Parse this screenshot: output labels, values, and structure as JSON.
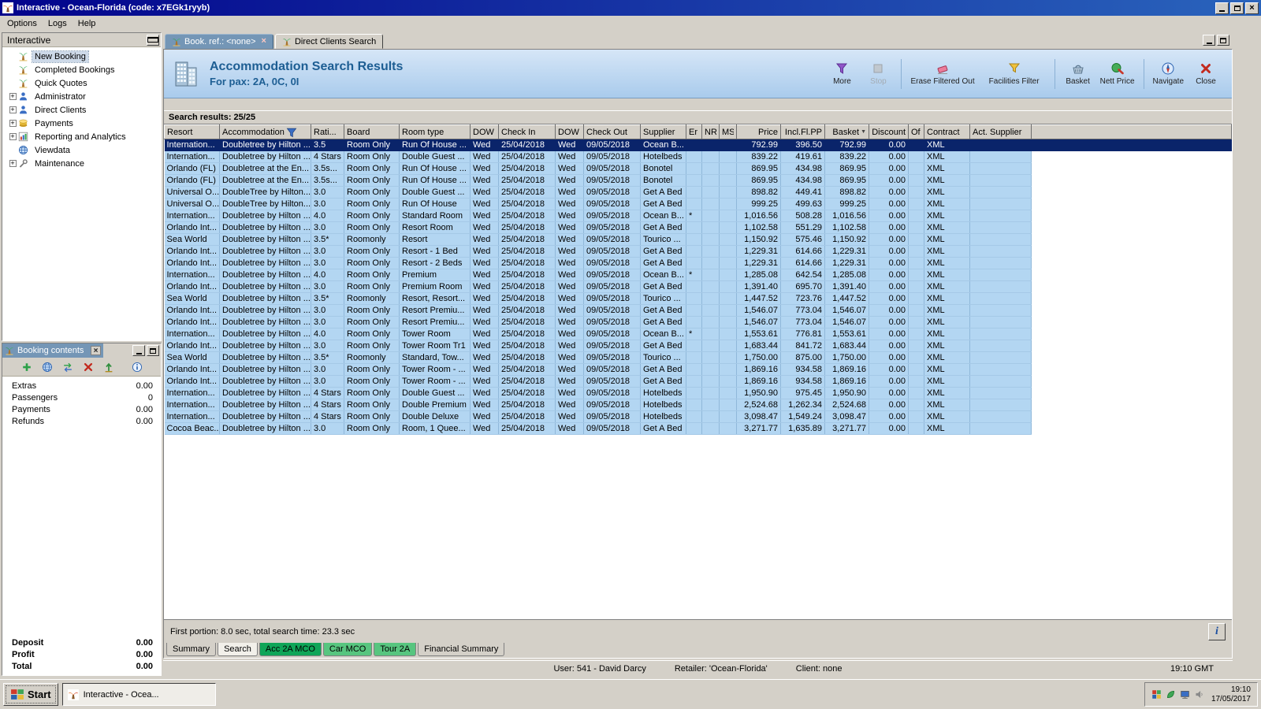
{
  "accent": {
    "selection_blue": "#0a246a",
    "row_blue": "#b3d6f2",
    "header_blue": "#a9cbec",
    "tab_green": "#0fa558",
    "caption_slate": "#7496b6"
  },
  "window": {
    "title": "Interactive - Ocean-Florida (code: x7EGk1ryyb)",
    "menu": [
      {
        "label": "Options"
      },
      {
        "label": "Logs"
      },
      {
        "label": "Help"
      }
    ]
  },
  "sidebar": {
    "title": "Interactive",
    "items": [
      {
        "label": "New Booking",
        "icon": "palm-icon",
        "expandable": false,
        "selected": true
      },
      {
        "label": "Completed Bookings",
        "icon": "palm-icon",
        "expandable": false,
        "selected": false
      },
      {
        "label": "Quick Quotes",
        "icon": "palm-icon",
        "expandable": false,
        "selected": false
      },
      {
        "label": "Administrator",
        "icon": "person-icon",
        "expandable": true,
        "selected": false
      },
      {
        "label": "Direct Clients",
        "icon": "person-icon",
        "expandable": true,
        "selected": false
      },
      {
        "label": "Payments",
        "icon": "payment-icon",
        "expandable": true,
        "selected": false
      },
      {
        "label": "Reporting and Analytics",
        "icon": "report-icon",
        "expandable": true,
        "selected": false
      },
      {
        "label": "Viewdata",
        "icon": "globe-icon",
        "expandable": false,
        "selected": false
      },
      {
        "label": "Maintenance",
        "icon": "tools-icon",
        "expandable": true,
        "selected": false
      }
    ]
  },
  "booking_contents": {
    "title": "Booking contents",
    "toolbar": [
      {
        "name": "add-icon"
      },
      {
        "name": "globe-icon"
      },
      {
        "name": "transfer-icon"
      },
      {
        "name": "delete-icon"
      },
      {
        "name": "export-icon"
      },
      {
        "name": "info-icon"
      }
    ],
    "items": [
      {
        "label": "Extras",
        "value": "0.00"
      },
      {
        "label": "Passengers",
        "value": "0"
      },
      {
        "label": "Payments",
        "value": "0.00"
      },
      {
        "label": "Refunds",
        "value": "0.00"
      }
    ],
    "totals": [
      {
        "label": "Deposit",
        "value": "0.00"
      },
      {
        "label": "Profit",
        "value": "0.00"
      },
      {
        "label": "Total",
        "value": "0.00"
      }
    ]
  },
  "main": {
    "tabs": [
      {
        "label": "Book. ref.: <none>",
        "active": true,
        "closable": true,
        "icon": "palm-icon"
      },
      {
        "label": "Direct Clients Search",
        "active": false,
        "closable": false,
        "icon": "palm-icon"
      }
    ],
    "header": {
      "title": "Accommodation Search Results",
      "subtitle": "For pax: 2A, 0C, 0I",
      "buttons": [
        {
          "label": "More",
          "icon": "filter-more-icon",
          "disabled": false,
          "wide": false
        },
        {
          "label": "Stop",
          "icon": "stop-icon",
          "disabled": true,
          "wide": false
        },
        {
          "label": "Erase Filtered Out",
          "icon": "eraser-icon",
          "disabled": false,
          "wide": true
        },
        {
          "label": "Facilities Filter",
          "icon": "funnel-icon",
          "disabled": false,
          "wide": true
        },
        {
          "label": "Basket",
          "icon": "basket-icon",
          "disabled": false,
          "wide": false
        },
        {
          "label": "Nett Price",
          "icon": "price-icon",
          "disabled": false,
          "wide": false
        },
        {
          "label": "Navigate",
          "icon": "navigate-icon",
          "disabled": false,
          "wide": false
        },
        {
          "label": "Close",
          "icon": "close-red-icon",
          "disabled": false,
          "wide": false
        }
      ]
    },
    "results_label": "Search results: 25/25",
    "table": {
      "selected_row": 0,
      "columns": [
        "Resort",
        "Accommodation",
        "Rati...",
        "Board",
        "Room type",
        "DOW",
        "Check In",
        "DOW",
        "Check Out",
        "Supplier",
        "Er",
        "NR",
        "MS",
        "Price",
        "Incl.Fl.PP",
        "Basket",
        "Discount",
        "Of",
        "Contract",
        "Act. Supplier"
      ],
      "rows": [
        [
          "Internation...",
          "Doubletree by Hilton ...",
          "3.5",
          "Room Only",
          "Run Of House ...",
          "Wed",
          "25/04/2018",
          "Wed",
          "09/05/2018",
          "Ocean B...",
          "",
          "",
          "",
          "792.99",
          "396.50",
          "792.99",
          "0.00",
          "",
          "XML",
          ""
        ],
        [
          "Internation...",
          "Doubletree by Hilton ...",
          "4 Stars",
          "Room Only",
          "Double Guest ...",
          "Wed",
          "25/04/2018",
          "Wed",
          "09/05/2018",
          "Hotelbeds",
          "",
          "",
          "",
          "839.22",
          "419.61",
          "839.22",
          "0.00",
          "",
          "XML",
          ""
        ],
        [
          "Orlando (FL)",
          "Doubletree at the En...",
          "3.5s...",
          "Room Only",
          "Run Of House ...",
          "Wed",
          "25/04/2018",
          "Wed",
          "09/05/2018",
          "Bonotel",
          "",
          "",
          "",
          "869.95",
          "434.98",
          "869.95",
          "0.00",
          "",
          "XML",
          ""
        ],
        [
          "Orlando (FL)",
          "Doubletree at the En...",
          "3.5s...",
          "Room Only",
          "Run Of House ...",
          "Wed",
          "25/04/2018",
          "Wed",
          "09/05/2018",
          "Bonotel",
          "",
          "",
          "",
          "869.95",
          "434.98",
          "869.95",
          "0.00",
          "",
          "XML",
          ""
        ],
        [
          "Universal O...",
          "DoubleTree by Hilton...",
          "3.0",
          "Room Only",
          "Double Guest ...",
          "Wed",
          "25/04/2018",
          "Wed",
          "09/05/2018",
          "Get A Bed",
          "",
          "",
          "",
          "898.82",
          "449.41",
          "898.82",
          "0.00",
          "",
          "XML",
          ""
        ],
        [
          "Universal O...",
          "DoubleTree by Hilton...",
          "3.0",
          "Room Only",
          "Run Of House",
          "Wed",
          "25/04/2018",
          "Wed",
          "09/05/2018",
          "Get A Bed",
          "",
          "",
          "",
          "999.25",
          "499.63",
          "999.25",
          "0.00",
          "",
          "XML",
          ""
        ],
        [
          "Internation...",
          "Doubletree by Hilton ...",
          "4.0",
          "Room Only",
          "Standard Room",
          "Wed",
          "25/04/2018",
          "Wed",
          "09/05/2018",
          "Ocean B...",
          "*",
          "",
          "",
          "1,016.56",
          "508.28",
          "1,016.56",
          "0.00",
          "",
          "XML",
          ""
        ],
        [
          "Orlando Int...",
          "Doubletree by Hilton ...",
          "3.0",
          "Room Only",
          "Resort Room",
          "Wed",
          "25/04/2018",
          "Wed",
          "09/05/2018",
          "Get A Bed",
          "",
          "",
          "",
          "1,102.58",
          "551.29",
          "1,102.58",
          "0.00",
          "",
          "XML",
          ""
        ],
        [
          "Sea World",
          "Doubletree by Hilton ...",
          "3.5*",
          "Roomonly",
          "Resort",
          "Wed",
          "25/04/2018",
          "Wed",
          "09/05/2018",
          "Tourico ...",
          "",
          "",
          "",
          "1,150.92",
          "575.46",
          "1,150.92",
          "0.00",
          "",
          "XML",
          ""
        ],
        [
          "Orlando Int...",
          "Doubletree by Hilton ...",
          "3.0",
          "Room Only",
          "Resort - 1 Bed",
          "Wed",
          "25/04/2018",
          "Wed",
          "09/05/2018",
          "Get A Bed",
          "",
          "",
          "",
          "1,229.31",
          "614.66",
          "1,229.31",
          "0.00",
          "",
          "XML",
          ""
        ],
        [
          "Orlando Int...",
          "Doubletree by Hilton ...",
          "3.0",
          "Room Only",
          "Resort - 2 Beds",
          "Wed",
          "25/04/2018",
          "Wed",
          "09/05/2018",
          "Get A Bed",
          "",
          "",
          "",
          "1,229.31",
          "614.66",
          "1,229.31",
          "0.00",
          "",
          "XML",
          ""
        ],
        [
          "Internation...",
          "Doubletree by Hilton ...",
          "4.0",
          "Room Only",
          "Premium",
          "Wed",
          "25/04/2018",
          "Wed",
          "09/05/2018",
          "Ocean B...",
          "*",
          "",
          "",
          "1,285.08",
          "642.54",
          "1,285.08",
          "0.00",
          "",
          "XML",
          ""
        ],
        [
          "Orlando Int...",
          "Doubletree by Hilton ...",
          "3.0",
          "Room Only",
          "Premium Room",
          "Wed",
          "25/04/2018",
          "Wed",
          "09/05/2018",
          "Get A Bed",
          "",
          "",
          "",
          "1,391.40",
          "695.70",
          "1,391.40",
          "0.00",
          "",
          "XML",
          ""
        ],
        [
          "Sea World",
          "Doubletree by Hilton ...",
          "3.5*",
          "Roomonly",
          "Resort, Resort...",
          "Wed",
          "25/04/2018",
          "Wed",
          "09/05/2018",
          "Tourico ...",
          "",
          "",
          "",
          "1,447.52",
          "723.76",
          "1,447.52",
          "0.00",
          "",
          "XML",
          ""
        ],
        [
          "Orlando Int...",
          "Doubletree by Hilton ...",
          "3.0",
          "Room Only",
          "Resort Premiu...",
          "Wed",
          "25/04/2018",
          "Wed",
          "09/05/2018",
          "Get A Bed",
          "",
          "",
          "",
          "1,546.07",
          "773.04",
          "1,546.07",
          "0.00",
          "",
          "XML",
          ""
        ],
        [
          "Orlando Int...",
          "Doubletree by Hilton ...",
          "3.0",
          "Room Only",
          "Resort Premiu...",
          "Wed",
          "25/04/2018",
          "Wed",
          "09/05/2018",
          "Get A Bed",
          "",
          "",
          "",
          "1,546.07",
          "773.04",
          "1,546.07",
          "0.00",
          "",
          "XML",
          ""
        ],
        [
          "Internation...",
          "Doubletree by Hilton ...",
          "4.0",
          "Room Only",
          "Tower Room",
          "Wed",
          "25/04/2018",
          "Wed",
          "09/05/2018",
          "Ocean B...",
          "*",
          "",
          "",
          "1,553.61",
          "776.81",
          "1,553.61",
          "0.00",
          "",
          "XML",
          ""
        ],
        [
          "Orlando Int...",
          "Doubletree by Hilton ...",
          "3.0",
          "Room Only",
          "Tower Room Tr1",
          "Wed",
          "25/04/2018",
          "Wed",
          "09/05/2018",
          "Get A Bed",
          "",
          "",
          "",
          "1,683.44",
          "841.72",
          "1,683.44",
          "0.00",
          "",
          "XML",
          ""
        ],
        [
          "Sea World",
          "Doubletree by Hilton ...",
          "3.5*",
          "Roomonly",
          "Standard, Tow...",
          "Wed",
          "25/04/2018",
          "Wed",
          "09/05/2018",
          "Tourico ...",
          "",
          "",
          "",
          "1,750.00",
          "875.00",
          "1,750.00",
          "0.00",
          "",
          "XML",
          ""
        ],
        [
          "Orlando Int...",
          "Doubletree by Hilton ...",
          "3.0",
          "Room Only",
          "Tower Room - ...",
          "Wed",
          "25/04/2018",
          "Wed",
          "09/05/2018",
          "Get A Bed",
          "",
          "",
          "",
          "1,869.16",
          "934.58",
          "1,869.16",
          "0.00",
          "",
          "XML",
          ""
        ],
        [
          "Orlando Int...",
          "Doubletree by Hilton ...",
          "3.0",
          "Room Only",
          "Tower Room - ...",
          "Wed",
          "25/04/2018",
          "Wed",
          "09/05/2018",
          "Get A Bed",
          "",
          "",
          "",
          "1,869.16",
          "934.58",
          "1,869.16",
          "0.00",
          "",
          "XML",
          ""
        ],
        [
          "Internation...",
          "Doubletree by Hilton ...",
          "4 Stars",
          "Room Only",
          "Double Guest ...",
          "Wed",
          "25/04/2018",
          "Wed",
          "09/05/2018",
          "Hotelbeds",
          "",
          "",
          "",
          "1,950.90",
          "975.45",
          "1,950.90",
          "0.00",
          "",
          "XML",
          ""
        ],
        [
          "Internation...",
          "Doubletree by Hilton ...",
          "4 Stars",
          "Room Only",
          "Double Premium",
          "Wed",
          "25/04/2018",
          "Wed",
          "09/05/2018",
          "Hotelbeds",
          "",
          "",
          "",
          "2,524.68",
          "1,262.34",
          "2,524.68",
          "0.00",
          "",
          "XML",
          ""
        ],
        [
          "Internation...",
          "Doubletree by Hilton ...",
          "4 Stars",
          "Room Only",
          "Double Deluxe",
          "Wed",
          "25/04/2018",
          "Wed",
          "09/05/2018",
          "Hotelbeds",
          "",
          "",
          "",
          "3,098.47",
          "1,549.24",
          "3,098.47",
          "0.00",
          "",
          "XML",
          ""
        ],
        [
          "Cocoa Beac...",
          "Doubletree by Hilton ...",
          "3.0",
          "Room Only",
          "Room, 1 Quee...",
          "Wed",
          "25/04/2018",
          "Wed",
          "09/05/2018",
          "Get A Bed",
          "",
          "",
          "",
          "3,271.77",
          "1,635.89",
          "3,271.77",
          "0.00",
          "",
          "XML",
          ""
        ]
      ]
    },
    "search_status": "First portion: 8.0 sec, total search time: 23.3 sec",
    "info_button_label": "i",
    "bottom_tabs": [
      {
        "label": "Summary",
        "style": "grey"
      },
      {
        "label": "Search",
        "style": "active"
      },
      {
        "label": "Acc 2A MCO",
        "style": "green-dark"
      },
      {
        "label": "Car MCO",
        "style": "green"
      },
      {
        "label": "Tour 2A",
        "style": "green"
      },
      {
        "label": "Financial Summary",
        "style": "grey"
      }
    ],
    "statusbar": {
      "user": "User: 541 - David Darcy",
      "retailer": "Retailer: 'Ocean-Florida'",
      "client": "Client: none",
      "time": "19:10 GMT"
    }
  },
  "taskbar": {
    "start_label": "Start",
    "task_label": "Interactive - Ocea...",
    "tray_icons": [
      "grid-icon",
      "leaf-icon",
      "monitor-icon",
      "speaker-icon"
    ],
    "tray_time": "19:10",
    "tray_date": "17/05/2017"
  }
}
